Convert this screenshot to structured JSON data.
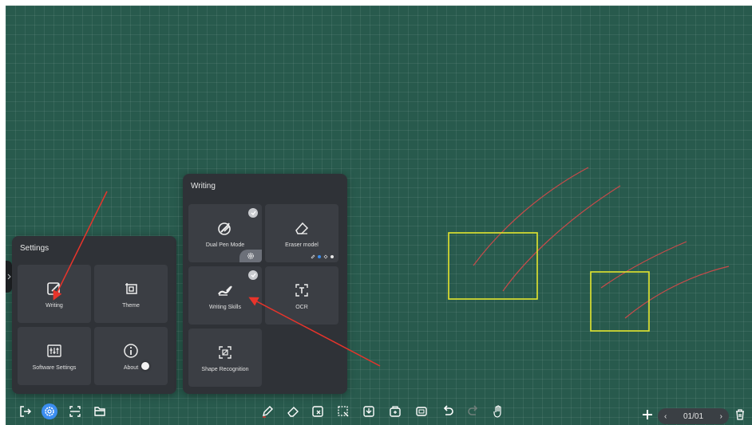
{
  "settings_panel": {
    "title": "Settings",
    "items": [
      {
        "label": "Writing",
        "icon": "edit-square-icon"
      },
      {
        "label": "Theme",
        "icon": "theme-icon"
      },
      {
        "label": "Software Settings",
        "icon": "sliders-icon"
      },
      {
        "label": "About",
        "icon": "info-icon"
      }
    ]
  },
  "writing_panel": {
    "title": "Writing",
    "items": [
      {
        "label": "Dual Pen Mode",
        "icon": "dual-pen-icon",
        "checked": true
      },
      {
        "label": "Eraser model",
        "icon": "eraser-icon"
      },
      {
        "label": "Writing Skills",
        "icon": "writing-skills-icon",
        "checked": true
      },
      {
        "label": "OCR",
        "icon": "ocr-icon"
      },
      {
        "label": "Shape Recognition",
        "icon": "shape-recognition-icon"
      }
    ]
  },
  "toolbar": {
    "left_icons": [
      "exit-icon",
      "settings-icon",
      "scan-icon",
      "folder-icon"
    ],
    "center_icons": [
      "pen-icon",
      "eraser-icon",
      "clear-icon",
      "select-icon",
      "import-icon",
      "tools-icon",
      "screen-icon",
      "undo-icon",
      "redo-icon",
      "roam-icon"
    ]
  },
  "page_nav": {
    "indicator": "01/01",
    "prev": "‹",
    "next": "›"
  },
  "colors": {
    "board": "#285a4d",
    "stroke": "#c94a4a",
    "annotation_box": "#e3e62e",
    "annotation_arrow": "#e8342b",
    "active_tool": "#3b8ef0"
  }
}
